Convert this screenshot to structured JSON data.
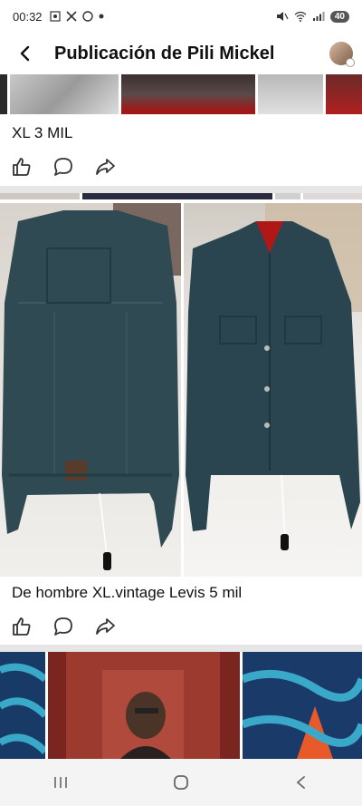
{
  "status_bar": {
    "time": "00:32",
    "battery": "40"
  },
  "header": {
    "title": "Publicación de Pili Mickel"
  },
  "posts": [
    {
      "caption": "XL 3 MIL"
    },
    {
      "caption": "De hombre XL.vintage Levis 5 mil"
    }
  ],
  "icons": {
    "back": "back-arrow-icon",
    "like": "thumbs-up-icon",
    "comment": "comment-bubble-icon",
    "share": "share-arrow-icon",
    "recents": "recents-icon",
    "home": "home-icon",
    "nav_back": "back-chevron-icon"
  }
}
